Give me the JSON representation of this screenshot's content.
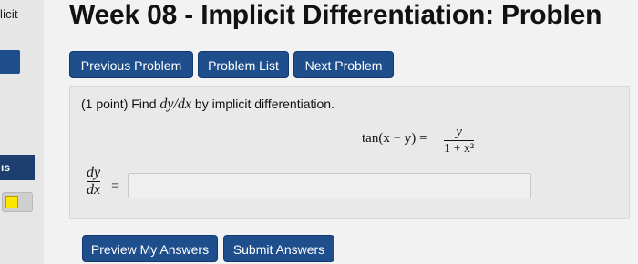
{
  "sidebar": {
    "title": "licit",
    "section_label": "ıs"
  },
  "header": {
    "title": "Week 08 - Implicit Differentiation: Problen"
  },
  "nav": {
    "previous_label": "Previous Problem",
    "list_label": "Problem List",
    "next_label": "Next Problem"
  },
  "problem": {
    "points": "(1 point) Find",
    "derivative": "dy/dx",
    "instruction": "by implicit differentiation.",
    "equation_lhs": "tan(x − y) =",
    "equation_rhs_num": "y",
    "equation_rhs_den": "1 + x²",
    "answer_num": "dy",
    "answer_den": "dx",
    "answer_equals": "=",
    "answer_value": ""
  },
  "actions": {
    "preview_label": "Preview My Answers",
    "submit_label": "Submit Answers"
  },
  "colors": {
    "button_blue": "#1f4e8c",
    "status_yellow": "#ffe600"
  }
}
